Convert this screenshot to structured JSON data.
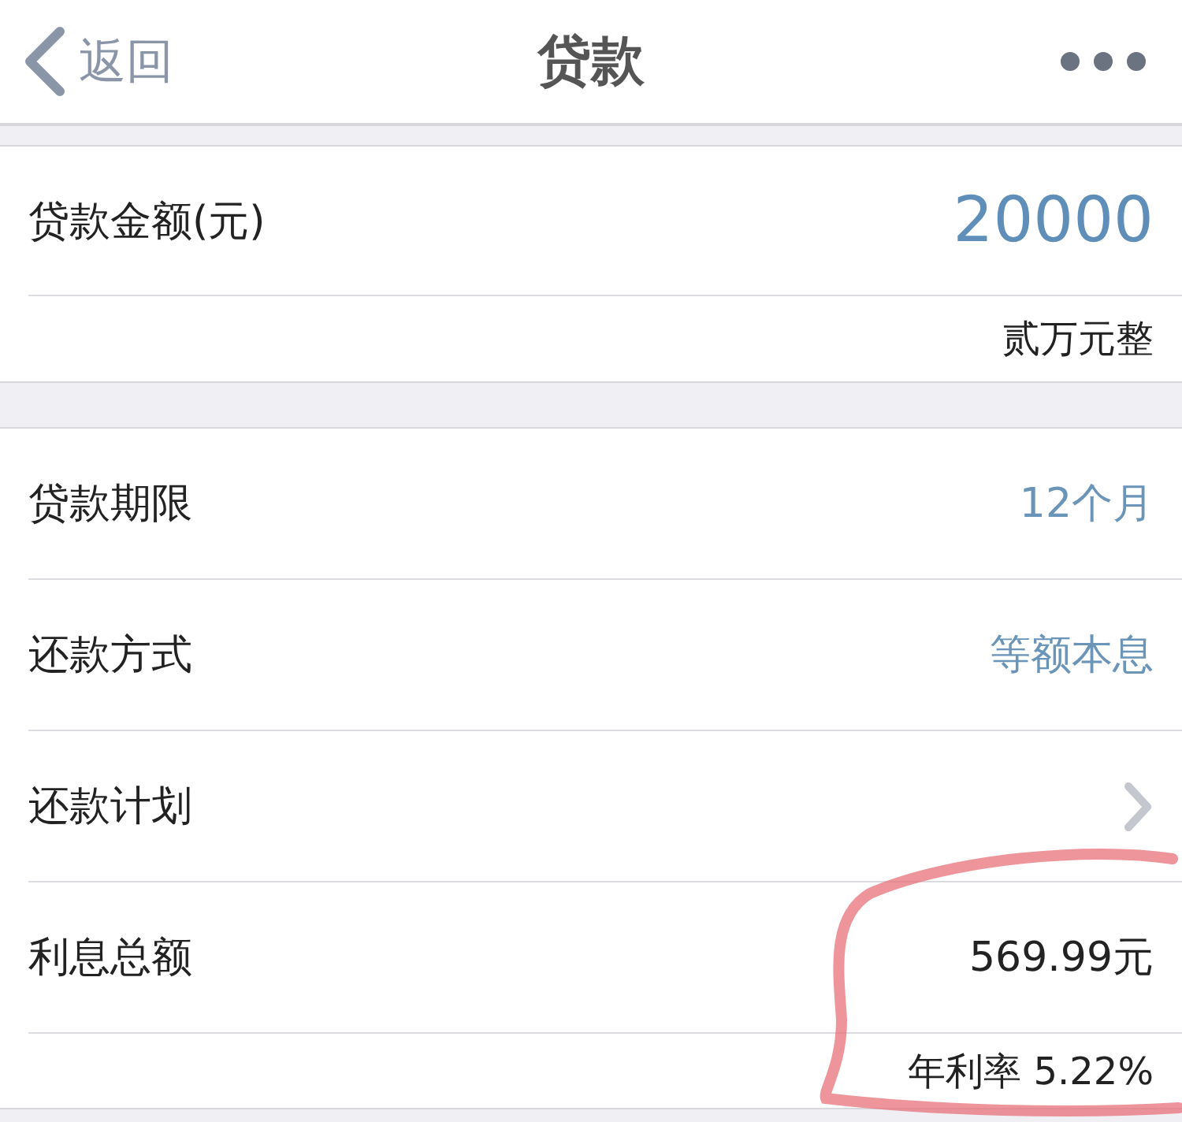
{
  "nav": {
    "back_label": "返回",
    "title": "贷款"
  },
  "amount": {
    "label": "贷款金额(元)",
    "value": "20000",
    "in_words": "贰万元整"
  },
  "rows": [
    {
      "kind": "picker",
      "label": "贷款期限",
      "value": "12个月"
    },
    {
      "kind": "picker",
      "label": "还款方式",
      "value": "等额本息"
    },
    {
      "kind": "link",
      "label": "还款计划"
    },
    {
      "kind": "text",
      "label": "利息总额",
      "value": "569.99元"
    }
  ],
  "annual_rate": "年利率 5.22%",
  "annotation": {
    "kind": "circle"
  }
}
